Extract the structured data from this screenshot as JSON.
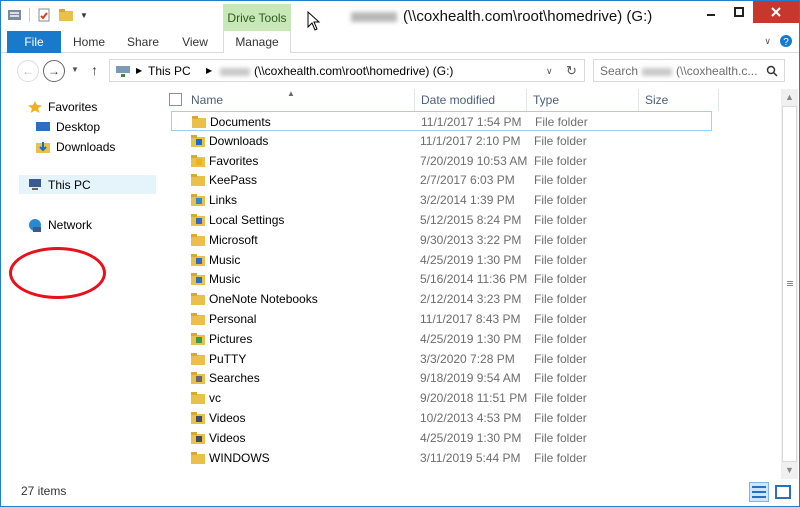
{
  "title_bar": {
    "contextual_tab": "Drive Tools",
    "title": "(\\\\coxhealth.com\\root\\homedrive) (G:)"
  },
  "ribbon": {
    "tabs": [
      "File",
      "Home",
      "Share",
      "View",
      "Manage"
    ]
  },
  "address_bar": {
    "root": "This PC",
    "path": "(\\\\coxhealth.com\\root\\homedrive) (G:)"
  },
  "search": {
    "placeholder_prefix": "Search",
    "placeholder_suffix": "(\\\\coxhealth.c..."
  },
  "nav_pane": {
    "favorites": "Favorites",
    "desktop": "Desktop",
    "downloads": "Downloads",
    "this_pc": "This PC",
    "network": "Network"
  },
  "columns": {
    "name": "Name",
    "date": "Date modified",
    "type": "Type",
    "size": "Size"
  },
  "files": [
    {
      "name": "Documents",
      "date": "11/1/2017 1:54 PM",
      "type": "File folder",
      "icon": "folder-icon"
    },
    {
      "name": "Downloads",
      "date": "11/1/2017 2:10 PM",
      "type": "File folder",
      "icon": "downloads-folder-icon"
    },
    {
      "name": "Favorites",
      "date": "7/20/2019 10:53 AM",
      "type": "File folder",
      "icon": "favorites-folder-icon"
    },
    {
      "name": "KeePass",
      "date": "2/7/2017 6:03 PM",
      "type": "File folder",
      "icon": "folder-icon"
    },
    {
      "name": "Links",
      "date": "3/2/2014 1:39 PM",
      "type": "File folder",
      "icon": "links-folder-icon"
    },
    {
      "name": "Local Settings",
      "date": "5/12/2015 8:24 PM",
      "type": "File folder",
      "icon": "shortcut-folder-icon"
    },
    {
      "name": "Microsoft",
      "date": "9/30/2013 3:22 PM",
      "type": "File folder",
      "icon": "folder-icon"
    },
    {
      "name": "Music",
      "date": "4/25/2019 1:30 PM",
      "type": "File folder",
      "icon": "music-folder-icon"
    },
    {
      "name": "Music",
      "date": "5/16/2014 11:36 PM",
      "type": "File folder",
      "icon": "music-folder-icon"
    },
    {
      "name": "OneNote Notebooks",
      "date": "2/12/2014 3:23 PM",
      "type": "File folder",
      "icon": "folder-icon"
    },
    {
      "name": "Personal",
      "date": "11/1/2017 8:43 PM",
      "type": "File folder",
      "icon": "folder-icon"
    },
    {
      "name": "Pictures",
      "date": "4/25/2019 1:30 PM",
      "type": "File folder",
      "icon": "pictures-folder-icon"
    },
    {
      "name": "PuTTY",
      "date": "3/3/2020 7:28 PM",
      "type": "File folder",
      "icon": "folder-icon"
    },
    {
      "name": "Searches",
      "date": "9/18/2019 9:54 AM",
      "type": "File folder",
      "icon": "searches-folder-icon"
    },
    {
      "name": "vc",
      "date": "9/20/2018 11:51 PM",
      "type": "File folder",
      "icon": "folder-icon"
    },
    {
      "name": "Videos",
      "date": "10/2/2013 4:53 PM",
      "type": "File folder",
      "icon": "videos-folder-icon"
    },
    {
      "name": "Videos",
      "date": "4/25/2019 1:30 PM",
      "type": "File folder",
      "icon": "videos-folder-icon"
    },
    {
      "name": "WINDOWS",
      "date": "3/11/2019 5:44 PM",
      "type": "File folder",
      "icon": "folder-icon"
    }
  ],
  "status": {
    "item_count": "27 items"
  },
  "colors": {
    "accent": "#1979ca",
    "drive_tools": "#c9e8b8",
    "annotation": "#e8101b"
  }
}
